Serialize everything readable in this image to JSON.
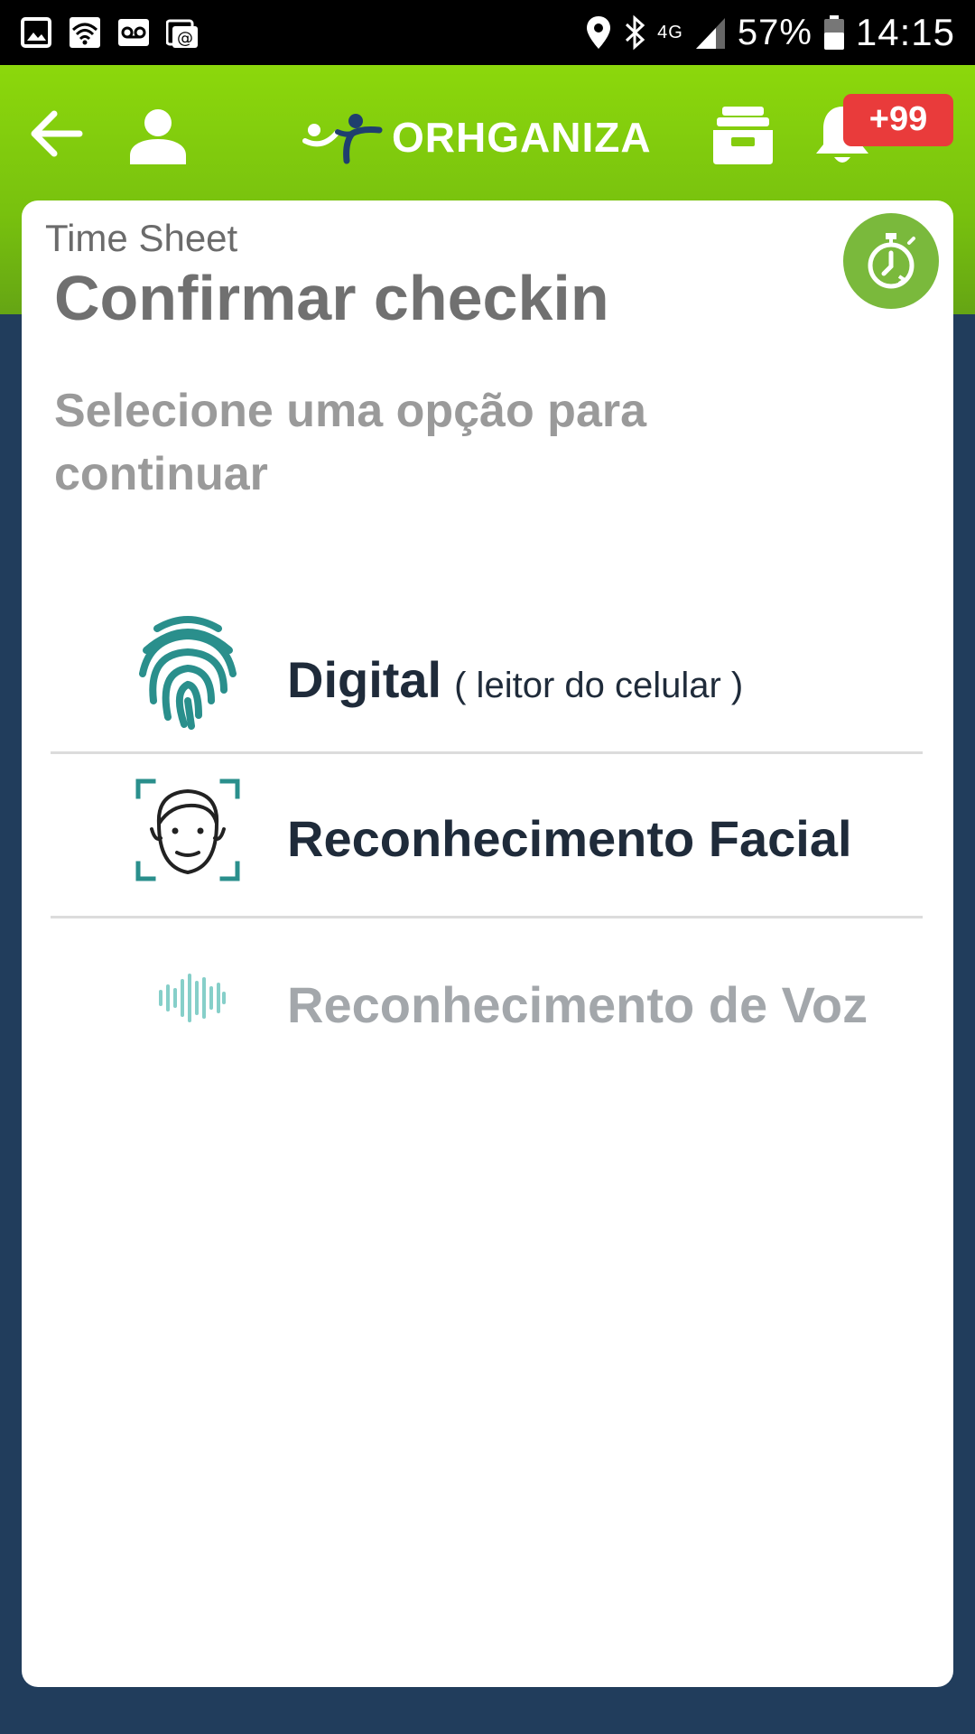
{
  "status_bar": {
    "battery": "57%",
    "time": "14:15",
    "network": "4G",
    "icons": [
      "image-icon",
      "wifi-icon",
      "voicemail-icon",
      "email-icon",
      "location-icon",
      "bluetooth-icon",
      "signal-icon",
      "battery-icon"
    ]
  },
  "header": {
    "logo_text": "ORHGANIZA",
    "notification_badge": "+99",
    "icons": [
      "back-arrow-icon",
      "user-icon",
      "inbox-icon",
      "bell-icon"
    ],
    "accent_color": "#7ec50c"
  },
  "page": {
    "breadcrumb": "Time Sheet",
    "title": "Confirmar checkin",
    "instructions": "Selecione uma opção para continuar"
  },
  "options": [
    {
      "label": "Digital",
      "sublabel": "( leitor do celular )",
      "icon": "fingerprint-icon",
      "enabled": true
    },
    {
      "label": "Reconhecimento Facial",
      "icon": "face-recognition-icon",
      "enabled": true
    },
    {
      "label": "Reconhecimento de Voz",
      "icon": "voice-wave-icon",
      "enabled": false
    }
  ],
  "colors": {
    "background": "#213d5c",
    "icon_teal": "#2a8f8c",
    "timer_green": "#7ab93c",
    "badge_red": "#e93b3b"
  }
}
